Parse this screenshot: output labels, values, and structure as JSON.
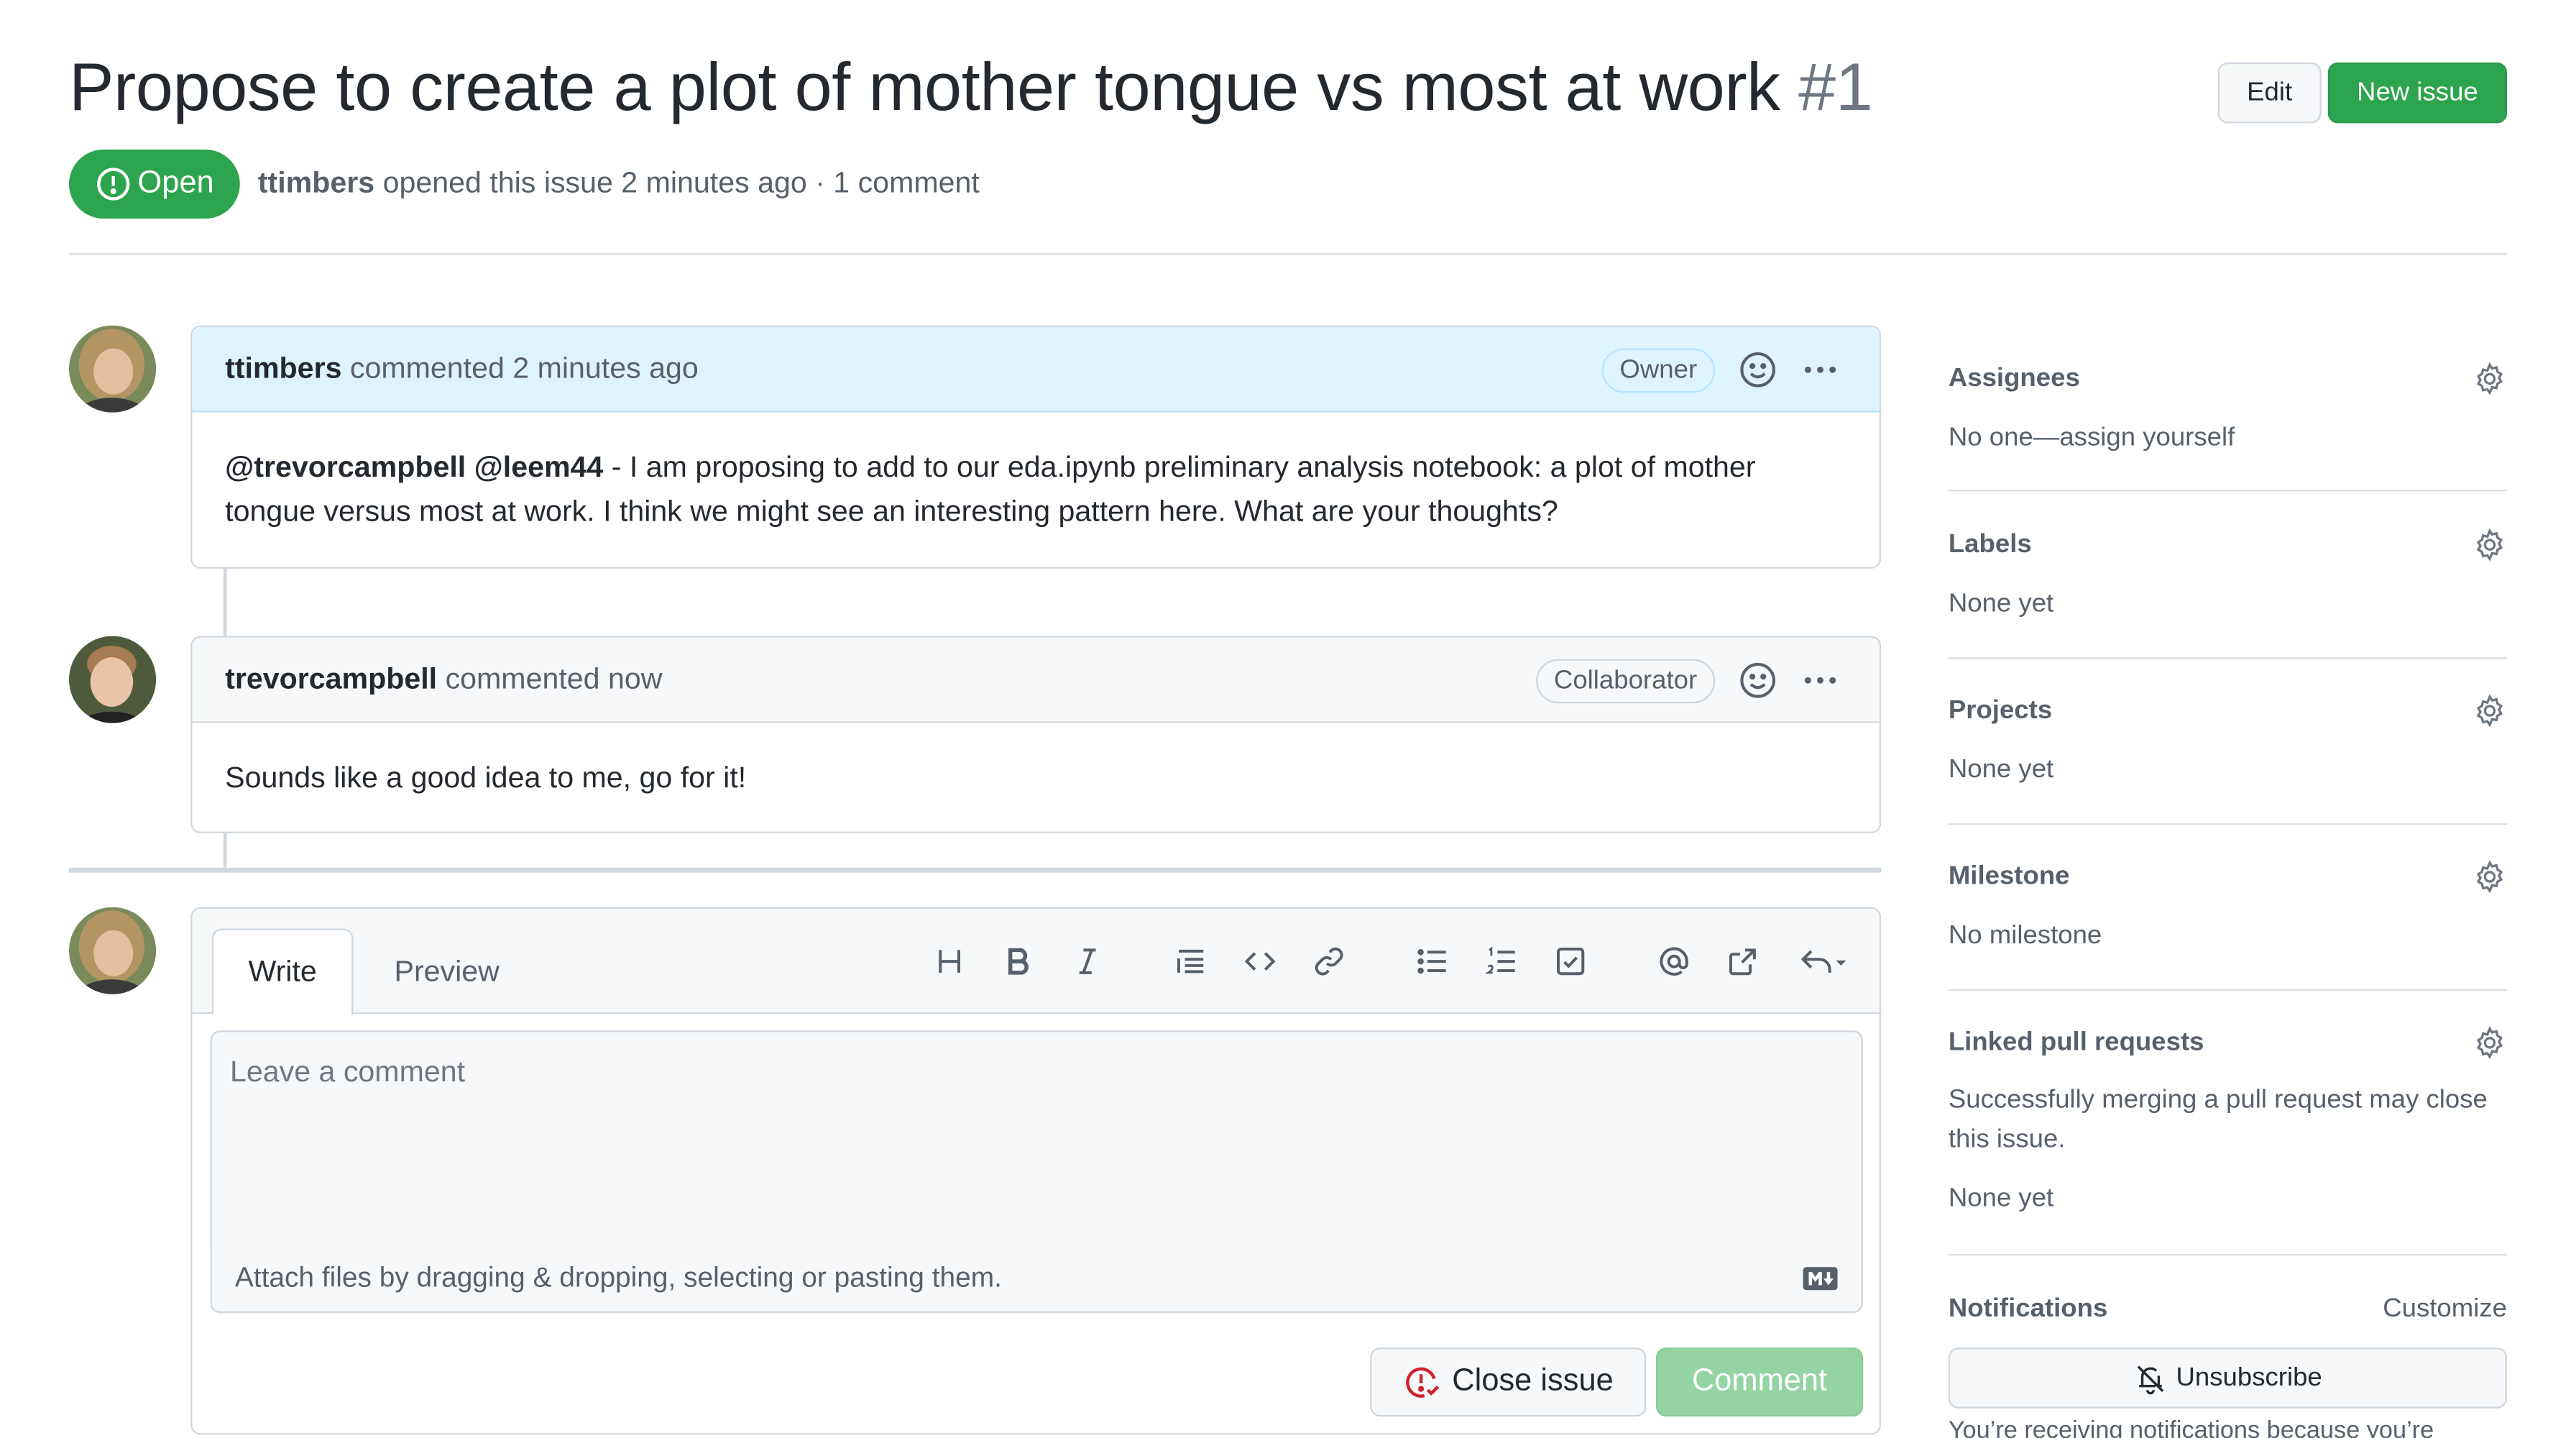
{
  "issue": {
    "title": "Propose to create a plot of mother tongue vs most at work",
    "number": "#1",
    "state": "Open",
    "author": "ttimbers",
    "meta_text": "opened this issue 2 minutes ago · 1 comment"
  },
  "header_buttons": {
    "edit": "Edit",
    "new_issue": "New issue"
  },
  "comments": [
    {
      "author": "ttimbers",
      "action": "commented 2 minutes ago",
      "role": "Owner",
      "mentions": "@trevorcampbell @leem44",
      "body": " - I am proposing to add to our eda.ipynb preliminary analysis notebook: a plot of mother tongue versus most at work. I think we might see an interesting pattern here. What are your thoughts?"
    },
    {
      "author": "trevorcampbell",
      "action": "commented now",
      "role": "Collaborator",
      "body": "Sounds like a good idea to me, go for it!"
    }
  ],
  "editor": {
    "tab_write": "Write",
    "tab_preview": "Preview",
    "placeholder": "Leave a comment",
    "attach_text": "Attach files by dragging & dropping, selecting or pasting them.",
    "close_issue": "Close issue",
    "comment": "Comment",
    "toolbar_icons": [
      "heading-icon",
      "bold-icon",
      "italic-icon",
      "quote-icon",
      "code-icon",
      "link-icon",
      "unordered-list-icon",
      "ordered-list-icon",
      "task-list-icon",
      "mention-icon",
      "cross-reference-icon",
      "reply-icon"
    ]
  },
  "sidebar": {
    "assignees": {
      "title": "Assignees",
      "value": "No one—assign yourself"
    },
    "labels": {
      "title": "Labels",
      "value": "None yet"
    },
    "projects": {
      "title": "Projects",
      "value": "None yet"
    },
    "milestone": {
      "title": "Milestone",
      "value": "No milestone"
    },
    "linked_prs": {
      "title": "Linked pull requests",
      "description": "Successfully merging a pull request may close this issue.",
      "value": "None yet"
    },
    "notifications": {
      "title": "Notifications",
      "customize": "Customize",
      "unsubscribe": "Unsubscribe",
      "note": "You’re receiving notifications because you’re"
    }
  },
  "colors": {
    "accent_green": "#2da44e",
    "disabled_green": "#94d3a2",
    "owner_header_bg": "#ddf4ff",
    "close_icon_red": "#cf222e"
  }
}
